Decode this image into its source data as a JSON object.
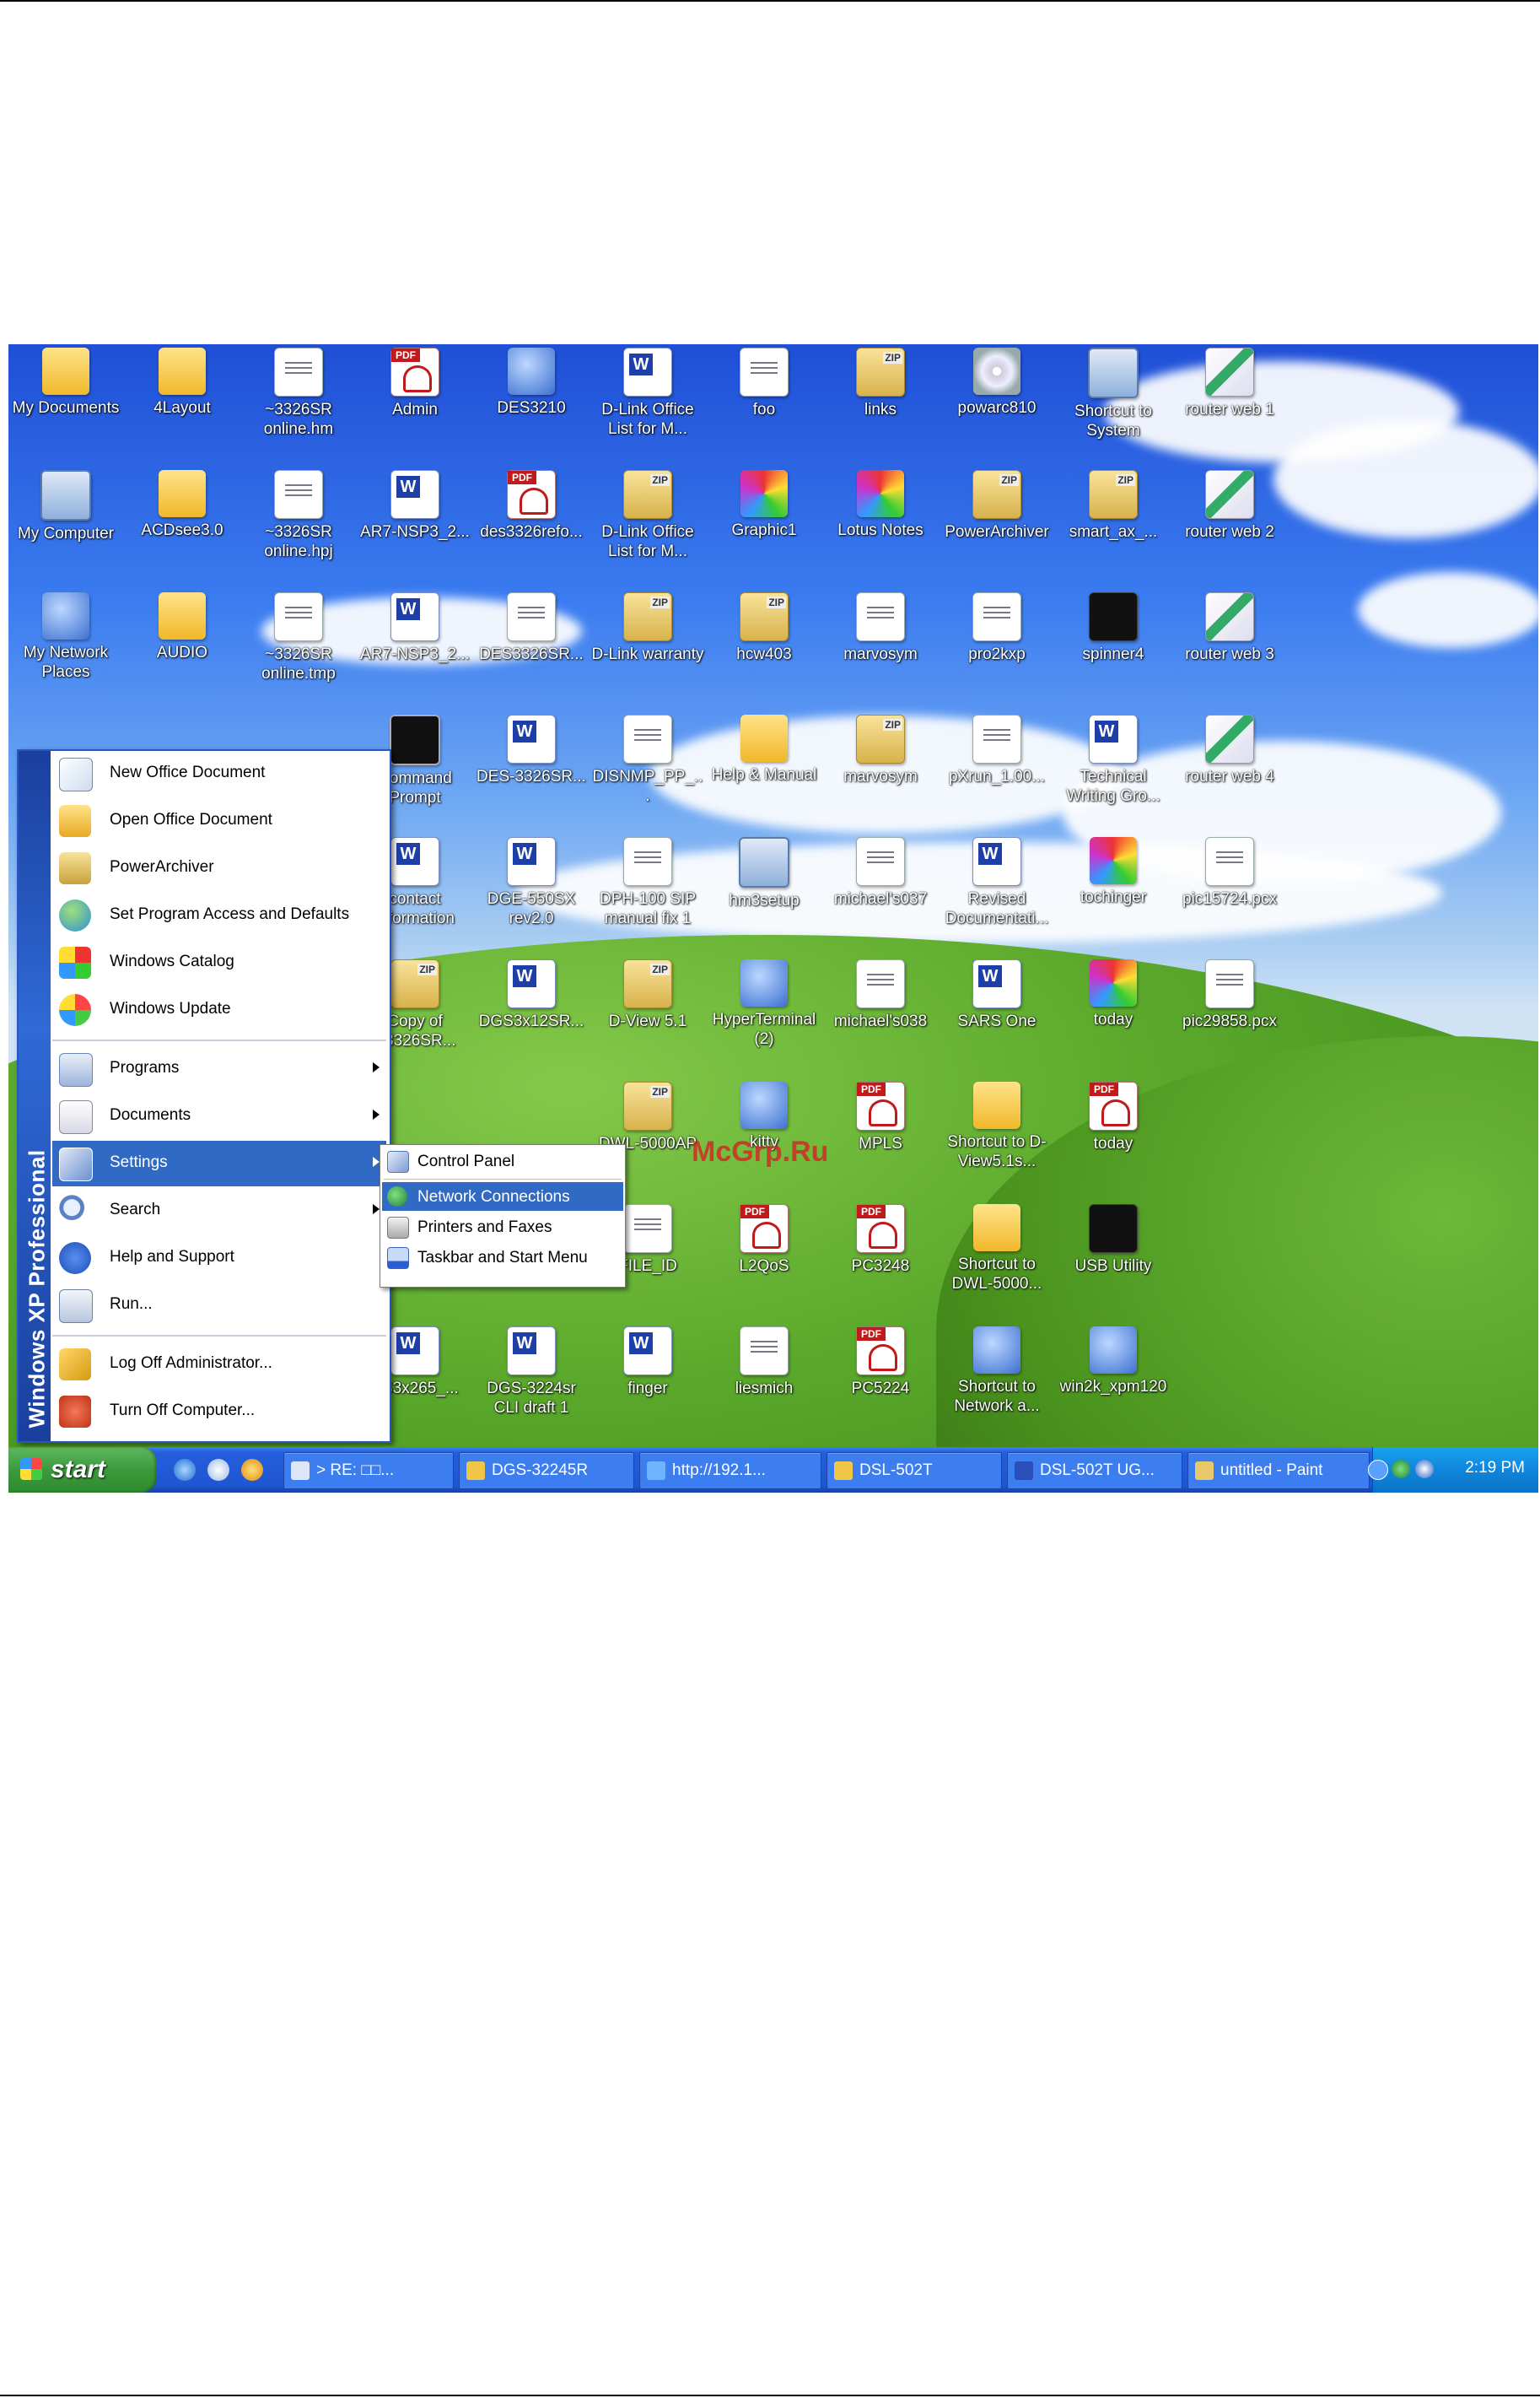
{
  "desktop": {
    "icons": [
      {
        "label": "My Documents",
        "kind": "folder"
      },
      {
        "label": "4Layout",
        "kind": "folder"
      },
      {
        "label": "~3326SR online.hm",
        "kind": "doc"
      },
      {
        "label": "Admin",
        "kind": "pdf"
      },
      {
        "label": "DES3210",
        "kind": "blue"
      },
      {
        "label": "D-Link Office List for M...",
        "kind": "word"
      },
      {
        "label": "foo",
        "kind": "doc"
      },
      {
        "label": "links",
        "kind": "zip"
      },
      {
        "label": "powarc810",
        "kind": "cd"
      },
      {
        "label": "Shortcut to System",
        "kind": "computer"
      },
      {
        "label": "router web 1",
        "kind": "brush"
      },
      {
        "label": "My Computer",
        "kind": "computer"
      },
      {
        "label": "ACDsee3.0",
        "kind": "folder"
      },
      {
        "label": "~3326SR online.hpj",
        "kind": "doc"
      },
      {
        "label": "AR7-NSP3_2...",
        "kind": "word"
      },
      {
        "label": "des3326refo...",
        "kind": "pdf"
      },
      {
        "label": "D-Link Office List for M...",
        "kind": "zip"
      },
      {
        "label": "Graphic1",
        "kind": "color"
      },
      {
        "label": "Lotus Notes",
        "kind": "color"
      },
      {
        "label": "PowerArchiver",
        "kind": "zip"
      },
      {
        "label": "smart_ax_...",
        "kind": "zip"
      },
      {
        "label": "router web 2",
        "kind": "brush"
      },
      {
        "label": "My Network Places",
        "kind": "blue"
      },
      {
        "label": "AUDIO",
        "kind": "folder"
      },
      {
        "label": "~3326SR online.tmp",
        "kind": "doc"
      },
      {
        "label": "AR7-NSP3_2...",
        "kind": "word"
      },
      {
        "label": "DES3326SR...",
        "kind": "doc"
      },
      {
        "label": "D-Link warranty",
        "kind": "zip"
      },
      {
        "label": "hcw403",
        "kind": "zip"
      },
      {
        "label": "marvosym",
        "kind": "doc"
      },
      {
        "label": "pro2kxp",
        "kind": "doc"
      },
      {
        "label": "spinner4",
        "kind": "black"
      },
      {
        "label": "router web 3",
        "kind": "brush"
      },
      {
        "label": "Command Prompt",
        "kind": "term"
      },
      {
        "label": "DES-3326SR...",
        "kind": "word"
      },
      {
        "label": "DISNMP_PP_...",
        "kind": "doc"
      },
      {
        "label": "Help & Manual",
        "kind": "folder"
      },
      {
        "label": "marvosym",
        "kind": "zip"
      },
      {
        "label": "pXrun_1.00...",
        "kind": "doc"
      },
      {
        "label": "Technical Writing Gro...",
        "kind": "word"
      },
      {
        "label": "router web 4",
        "kind": "brush"
      },
      {
        "label": "contact information",
        "kind": "word"
      },
      {
        "label": "DGE-550SX rev2.0",
        "kind": "word"
      },
      {
        "label": "DPH-100 SIP manual fix 1",
        "kind": "doc"
      },
      {
        "label": "hm3setup",
        "kind": "computer"
      },
      {
        "label": "michael's037",
        "kind": "doc"
      },
      {
        "label": "Revised Documentati...",
        "kind": "word"
      },
      {
        "label": "tochinger",
        "kind": "color"
      },
      {
        "label": "pic15724.pcx",
        "kind": "doc"
      },
      {
        "label": "Copy of S3326SR...",
        "kind": "zip"
      },
      {
        "label": "DGS3x12SR...",
        "kind": "word"
      },
      {
        "label": "D-View 5.1",
        "kind": "zip"
      },
      {
        "label": "HyperTerminal (2)",
        "kind": "blue"
      },
      {
        "label": "michael's038",
        "kind": "doc"
      },
      {
        "label": "SARS One",
        "kind": "word"
      },
      {
        "label": "today",
        "kind": "color"
      },
      {
        "label": "pic29858.pcx",
        "kind": "doc"
      },
      {
        "label": "DWL-5000AP",
        "kind": "zip"
      },
      {
        "label": "kitty",
        "kind": "blue"
      },
      {
        "label": "MPLS",
        "kind": "pdf"
      },
      {
        "label": "Shortcut to D-View5.1s...",
        "kind": "folder"
      },
      {
        "label": "today",
        "kind": "pdf"
      },
      {
        "label": "FILE_ID",
        "kind": "doc"
      },
      {
        "label": "L2QoS",
        "kind": "pdf"
      },
      {
        "label": "PC3248",
        "kind": "pdf"
      },
      {
        "label": "Shortcut to DWL-5000...",
        "kind": "folder"
      },
      {
        "label": "USB Utility",
        "kind": "black"
      },
      {
        "label": "ES3x265_...",
        "kind": "word"
      },
      {
        "label": "DGS-3224sr CLI draft 1",
        "kind": "word"
      },
      {
        "label": "finger",
        "kind": "word"
      },
      {
        "label": "liesmich",
        "kind": "doc"
      },
      {
        "label": "PC5224",
        "kind": "pdf"
      },
      {
        "label": "Shortcut to Network a...",
        "kind": "blue"
      },
      {
        "label": "win2k_xpm120",
        "kind": "blue"
      }
    ]
  },
  "start_menu": {
    "brand": "Windows XP Professional",
    "pinned": [
      {
        "label": "New Office Document",
        "icon": "office-document-icon"
      },
      {
        "label": "Open Office Document",
        "icon": "open-folder-icon"
      },
      {
        "label": "PowerArchiver",
        "icon": "archive-icon"
      },
      {
        "label": "Set Program Access and Defaults",
        "icon": "globe-icon"
      },
      {
        "label": "Windows Catalog",
        "icon": "catalog-icon"
      },
      {
        "label": "Windows Update",
        "icon": "windows-update-icon"
      }
    ],
    "main": [
      {
        "label": "Programs",
        "icon": "programs-icon",
        "submenu": true
      },
      {
        "label": "Documents",
        "icon": "documents-icon",
        "submenu": true
      },
      {
        "label": "Settings",
        "icon": "settings-icon",
        "submenu": true,
        "highlighted": true
      },
      {
        "label": "Search",
        "icon": "search-icon",
        "submenu": true
      },
      {
        "label": "Help and Support",
        "icon": "help-icon"
      },
      {
        "label": "Run...",
        "icon": "run-icon"
      }
    ],
    "bottom": [
      {
        "label": "Log Off Administrator...",
        "icon": "key-icon"
      },
      {
        "label": "Turn Off Computer...",
        "icon": "power-icon"
      }
    ]
  },
  "settings_submenu": {
    "items": [
      {
        "label": "Control Panel",
        "icon": "control-panel-icon"
      },
      {
        "label": "Network Connections",
        "icon": "network-icon",
        "highlighted": true
      },
      {
        "label": "Printers and Faxes",
        "icon": "printer-icon"
      },
      {
        "label": "Taskbar and Start Menu",
        "icon": "taskbar-icon"
      }
    ]
  },
  "watermark": "McGrp.Ru",
  "taskbar": {
    "start_label": "start",
    "buttons": [
      {
        "label": "> RE: □□..."
      },
      {
        "label": "DGS-32245R"
      },
      {
        "label": "http://192.1..."
      },
      {
        "label": "DSL-502T"
      },
      {
        "label": "DSL-502T UG..."
      },
      {
        "label": "untitled - Paint"
      }
    ],
    "clock": "2:19 PM"
  },
  "colors": {
    "taskbar_blue": "#245edb",
    "start_green": "#3c9a3c",
    "highlight": "#316ac5",
    "tray_blue": "#0f86dc"
  }
}
